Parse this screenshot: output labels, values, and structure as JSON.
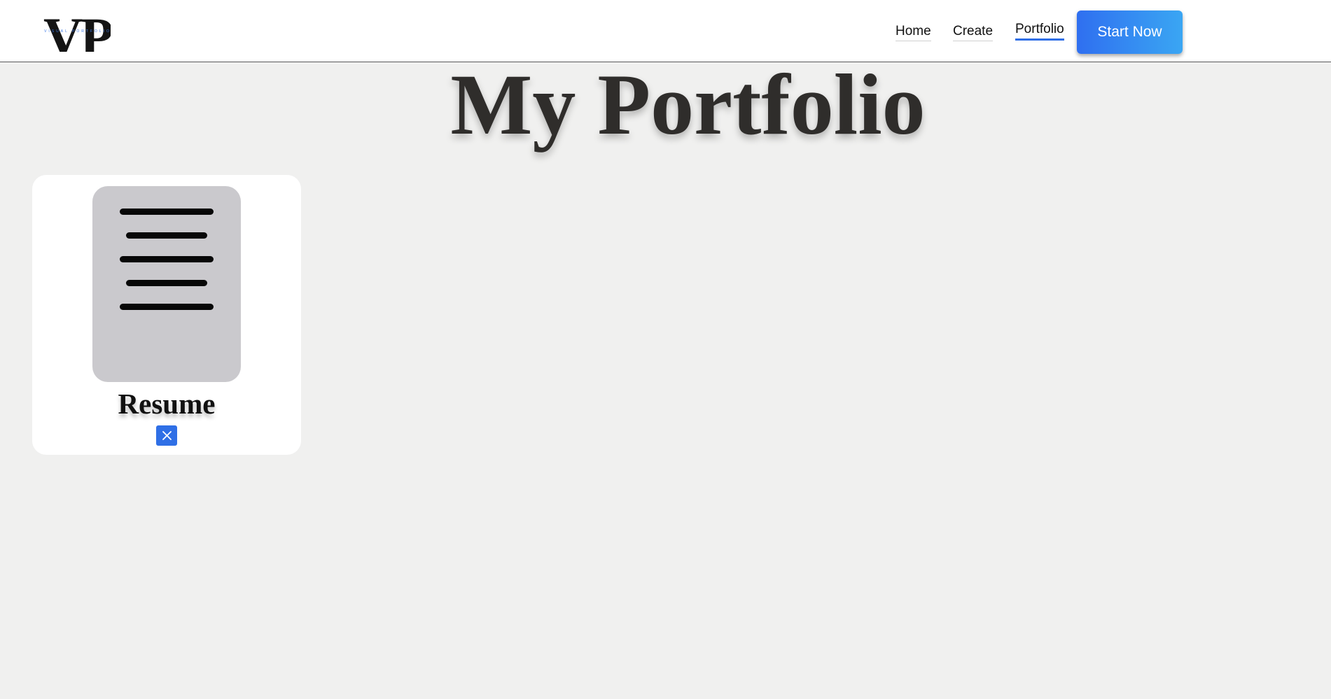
{
  "header": {
    "logo": {
      "letters": "VP",
      "tagline": "VISUAL PORTFOLIO"
    },
    "nav": {
      "home_label": "Home",
      "create_label": "Create",
      "portfolio_label": "Portfolio",
      "active": "Portfolio"
    },
    "cta_label": "Start Now"
  },
  "main": {
    "title": "My Portfolio",
    "cards": [
      {
        "title": "Resume",
        "icon": "document-icon",
        "delete_icon": "close-icon"
      }
    ]
  },
  "colors": {
    "accent": "#2f6fe6",
    "accent_gradient_end": "#3aa6f3",
    "page_background": "#f0f0ef",
    "card_background": "#ffffff",
    "document_icon_background": "#cac9cd",
    "title_text": "#2f2d2b"
  }
}
